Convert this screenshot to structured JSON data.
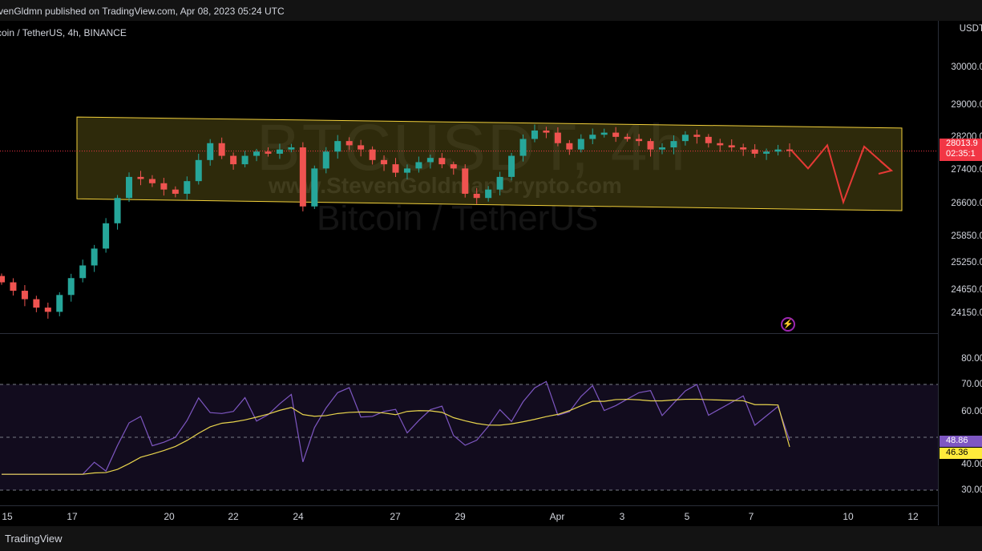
{
  "header": {
    "published_text": "venGldmn published on TradingView.com, Apr 08, 2023 05:24 UTC"
  },
  "chart": {
    "symbol_line": "coin / TetherUS, 4h, BINANCE",
    "watermark_ticker": "BTCUSDT, 4h",
    "watermark_url": "www.StevenGoldmanCrypto.com",
    "watermark_name": "Bitcoin / TetherUS"
  },
  "price_axis": {
    "currency": "USDT",
    "labels": [
      "30000.0",
      "29000.0",
      "28200.0",
      "27400.0",
      "26600.0",
      "25850.0",
      "25250.0",
      "24650.0",
      "24150.0"
    ],
    "current_price": "28013.9",
    "countdown": "02:35:1",
    "colors": {
      "price_badge": "#f23645",
      "rsi_badge": "#7e57c2",
      "ma_badge": "#ffeb3b"
    }
  },
  "rsi_axis": {
    "labels": [
      "80.00",
      "70.00",
      "60.00",
      "50.00",
      "40.00",
      "30.00"
    ],
    "rsi_value": "48.86",
    "ma_value": "46.36"
  },
  "time_axis": {
    "labels": [
      "15",
      "17",
      "20",
      "22",
      "24",
      "27",
      "29",
      "Apr",
      "3",
      "5",
      "7",
      "10",
      "12"
    ]
  },
  "footer": {
    "brand": "TradingView"
  },
  "icons": {
    "alert": "lightning-bolt-icon"
  },
  "chart_data": {
    "type": "candlestick",
    "title": "BTCUSDT, 4h",
    "ylabel": "USDT",
    "ylim": [
      24000,
      30400
    ],
    "x_start": "2023-03-15",
    "x_end": "2023-04-12",
    "channel": {
      "upper": [
        28820,
        28560
      ],
      "lower": [
        26880,
        26600
      ]
    },
    "rsi": {
      "upper_band": 70,
      "lower_band": 30,
      "mid": 50,
      "last_rsi": 48.86,
      "last_ma": 46.36
    },
    "approx_closes": [
      24900,
      24700,
      24500,
      24300,
      24200,
      24600,
      25000,
      25300,
      25700,
      26300,
      26900,
      27400,
      27350,
      27250,
      27100,
      27000,
      27300,
      27800,
      28200,
      27900,
      27700,
      27900,
      28000,
      27950,
      28050,
      28100,
      26700,
      27600,
      28000,
      28250,
      28150,
      28050,
      27800,
      27700,
      27500,
      27600,
      27750,
      27850,
      27700,
      27600,
      27000,
      26900,
      27100,
      27400,
      27900,
      28300,
      28500,
      28450,
      28200,
      28050,
      28300,
      28400,
      28450,
      28350,
      28300,
      28250,
      28050,
      28100,
      28250,
      28400,
      28350,
      28200,
      28150,
      28100,
      28050,
      27950,
      28000,
      28050,
      28013.9
    ]
  }
}
